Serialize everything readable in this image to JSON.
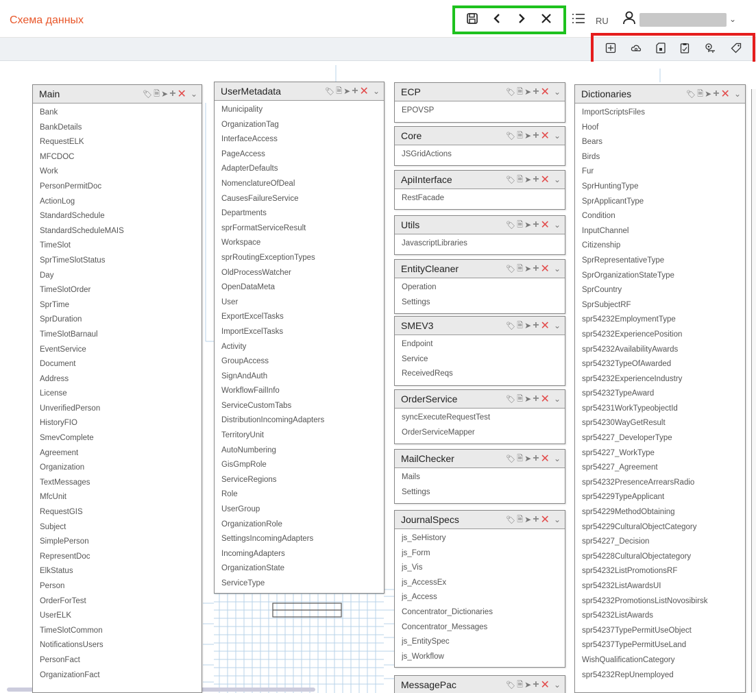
{
  "app": {
    "title": "Схема данных",
    "lang": "RU"
  },
  "icons": {
    "save": "save-icon",
    "back": "chevron-left-icon",
    "forward": "chevron-right-icon",
    "close": "close-icon",
    "list": "list-icon",
    "user": "user-icon",
    "tools": [
      "add-box-icon",
      "cloud-sync-icon",
      "sd-card-icon",
      "clipboard-icon",
      "key-location-icon",
      "tag-icon"
    ]
  },
  "colors": {
    "title_accent": "#e8572a",
    "nav_highlight": "#1ec21e",
    "tools_highlight": "#e51d1d",
    "delete_icon": "#e24a4a"
  },
  "entities": [
    {
      "title": "Main",
      "items": [
        "Bank",
        "BankDetails",
        "RequestELK",
        "MFCDOC",
        "Work",
        "PersonPermitDoc",
        "ActionLog",
        "StandardSchedule",
        "StandardScheduleMAIS",
        "TimeSlot",
        "SprTimeSlotStatus",
        "Day",
        "TimeSlotOrder",
        "SprTime",
        "SprDuration",
        "TimeSlotBarnaul",
        "EventService",
        "Document",
        "Address",
        "License",
        "UnverifiedPerson",
        "HistoryFIO",
        "SmevComplete",
        "Agreement",
        "Organization",
        "TextMessages",
        "MfcUnit",
        "RequestGIS",
        "Subject",
        "SimplePerson",
        "RepresentDoc",
        "ElkStatus",
        "Person",
        "OrderForTest",
        "UserELK",
        "TimeSlotCommon",
        "NotificationsUsers",
        "PersonFact",
        "OrganizationFact"
      ]
    },
    {
      "title": "UserMetadata",
      "items": [
        "Municipality",
        "OrganizationTag",
        "InterfaceAccess",
        "PageAccess",
        "AdapterDefaults",
        "NomenclatureOfDeal",
        "CausesFailureService",
        "Departments",
        "sprFormatServiceResult",
        "Workspace",
        "sprRoutingExceptionTypes",
        "OldProcessWatcher",
        "OpenDataMeta",
        "User",
        "ExportExcelTasks",
        "ImportExcelTasks",
        "Activity",
        "GroupAccess",
        "SignAndAuth",
        "WorkflowFailInfo",
        "ServiceCustomTabs",
        "DistributionIncomingAdapters",
        "TerritoryUnit",
        "AutoNumbering",
        "GisGmpRole",
        "ServiceRegions",
        "Role",
        "UserGroup",
        "OrganizationRole",
        "SettingsIncomingAdapters",
        "IncomingAdapters",
        "OrganizationState",
        "ServiceType"
      ]
    },
    {
      "title": "ECP",
      "items": [
        "EPOVSP"
      ]
    },
    {
      "title": "Core",
      "items": [
        "JSGridActions"
      ]
    },
    {
      "title": "ApiInterface",
      "items": [
        "RestFacade"
      ]
    },
    {
      "title": "Utils",
      "items": [
        "JavascriptLibraries"
      ]
    },
    {
      "title": "EntityCleaner",
      "items": [
        "Operation",
        "Settings"
      ]
    },
    {
      "title": "SMEV3",
      "items": [
        "Endpoint",
        "Service",
        "ReceivedReqs"
      ]
    },
    {
      "title": "OrderService",
      "items": [
        "syncExecuteRequestTest",
        "OrderServiceMapper"
      ]
    },
    {
      "title": "MailChecker",
      "items": [
        "Mails",
        "Settings"
      ]
    },
    {
      "title": "JournalSpecs",
      "items": [
        "js_SeHistory",
        "js_Form",
        "js_Vis",
        "js_AccessEx",
        "js_Access",
        "Concentrator_Dictionaries",
        "Concentrator_Messages",
        "js_EntitySpec",
        "js_Workflow"
      ]
    },
    {
      "title": "MessagePac",
      "items": []
    },
    {
      "title": "Dictionaries",
      "items": [
        "ImportScriptsFiles",
        "Hoof",
        "Bears",
        "Birds",
        "Fur",
        "SprHuntingType",
        "SprApplicantType",
        "Condition",
        "InputChannel",
        "Citizenship",
        "SprRepresentativeType",
        "SprOrganizationStateType",
        "SprCountry",
        "SprSubjectRF",
        "spr54232EmploymentType",
        "spr54232ExperiencePosition",
        "spr54232AvailabilityAwards",
        "spr54232TypeOfAwarded",
        "spr54232ExperienceIndustry",
        "spr54232TypeAward",
        "spr54231WorkTypeobjectId",
        "spr54230WayGetResult",
        "spr54227_DeveloperType",
        "spr54227_WorkType",
        "spr54227_Agreement",
        "spr54232PresenceArrearsRadio",
        "spr54229TypeApplicant",
        "spr54229MethodObtaining",
        "spr54229CulturalObjectCategory",
        "spr54227_Decision",
        "spr54228CulturalObjectategory",
        "spr54232ListPromotionsRF",
        "spr54232ListAwardsUI",
        "spr54232PromotionsListNovosibirsk",
        "spr54232ListAwards",
        "spr54237TypePermitUseObject",
        "spr54237TypePermitUseLand",
        "WishQualificationCategory",
        "spr54232RepUnemployed"
      ]
    }
  ]
}
